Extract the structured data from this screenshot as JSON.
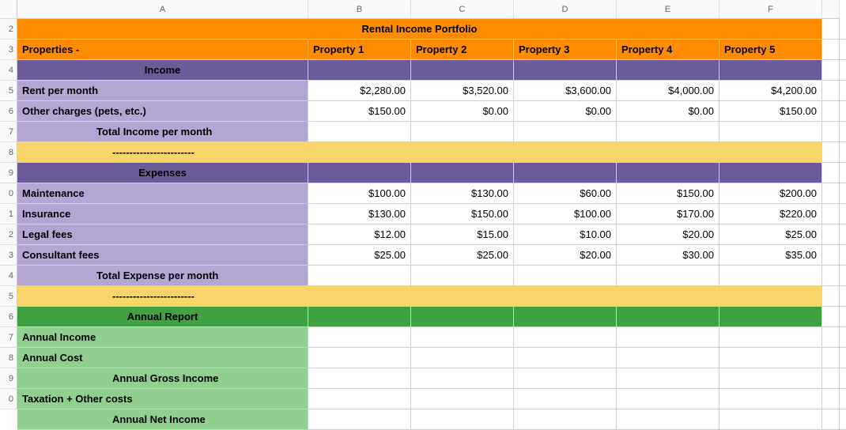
{
  "colLetters": [
    "A",
    "B",
    "C",
    "D",
    "E",
    "F",
    ""
  ],
  "rowNumbers": [
    "",
    "2",
    "3",
    "4",
    "5",
    "6",
    "7",
    "8",
    "9",
    "0",
    "1",
    "2",
    "3",
    "4",
    "5",
    "6",
    "7",
    "8",
    "9",
    "0"
  ],
  "title": "Rental Income Portfolio",
  "propertiesLabel": "Properties -",
  "propertyHeaders": [
    "Property 1",
    "Property 2",
    "Property 3",
    "Property 4",
    "Property 5"
  ],
  "incomeSection": "Income",
  "rentLabel": "Rent per month",
  "rentValues": [
    "$2,280.00",
    "$3,520.00",
    "$3,600.00",
    "$4,000.00",
    "$4,200.00"
  ],
  "otherChargesLabel": "Other charges (pets, etc.)",
  "otherChargesValues": [
    "$150.00",
    "$0.00",
    "$0.00",
    "$0.00",
    "$150.00"
  ],
  "totalIncomeLabel": "Total Income per month",
  "divider": "------------------------",
  "expensesSection": "Expenses",
  "maintenanceLabel": "Maintenance",
  "maintenanceValues": [
    "$100.00",
    "$130.00",
    "$60.00",
    "$150.00",
    "$200.00"
  ],
  "insuranceLabel": "Insurance",
  "insuranceValues": [
    "$130.00",
    "$150.00",
    "$100.00",
    "$170.00",
    "$220.00"
  ],
  "legalLabel": "Legal fees",
  "legalValues": [
    "$12.00",
    "$15.00",
    "$10.00",
    "$20.00",
    "$25.00"
  ],
  "consultantLabel": "Consultant fees",
  "consultantValues": [
    "$25.00",
    "$25.00",
    "$20.00",
    "$30.00",
    "$35.00"
  ],
  "totalExpenseLabel": "Total Expense per month",
  "annualReportSection": "Annual Report",
  "annualIncomeLabel": "Annual Income",
  "annualCostLabel": "Annual Cost",
  "annualGrossLabel": "Annual Gross Income",
  "taxationLabel": "Taxation + Other costs",
  "annualNetLabel": "Annual Net Income"
}
